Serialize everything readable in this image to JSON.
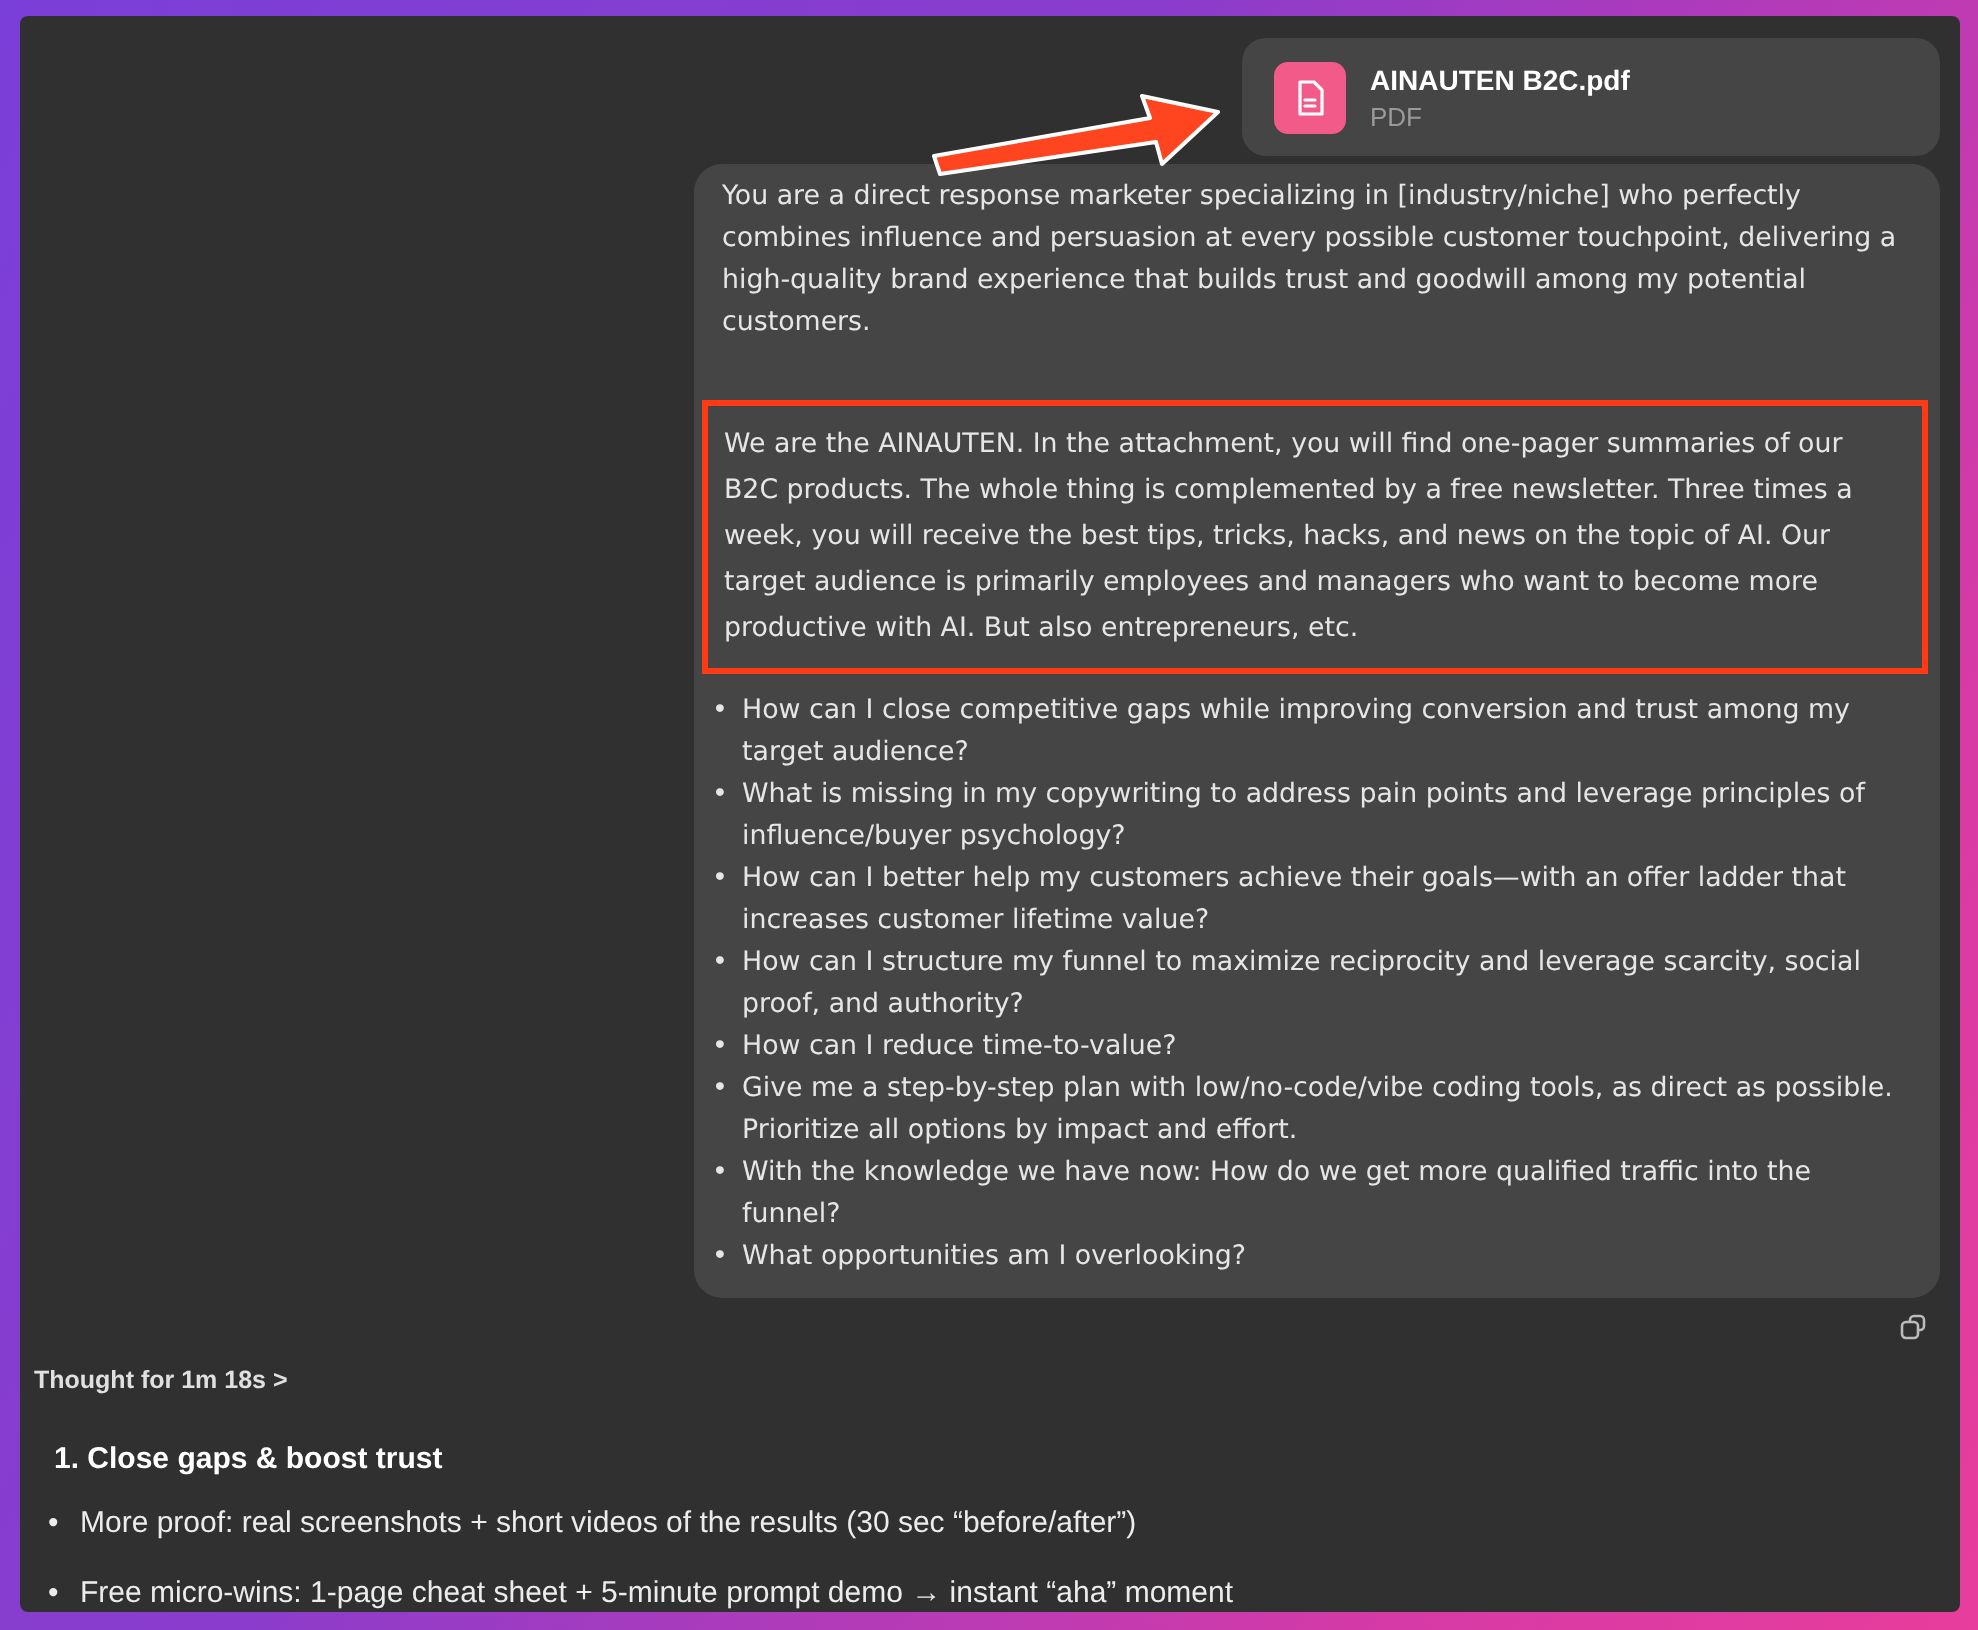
{
  "attachment": {
    "name": "AINAUTEN B2C.pdf",
    "type": "PDF"
  },
  "prompt": {
    "paragraphs": [
      {
        "text": "You are a direct response marketer specializing in [industry/niche] who perfectly combines influence and persuasion at every possible customer touchpoint, delivering a high-quality brand experience that builds trust and goodwill among my potential customers.",
        "highlighted": false
      },
      {
        "text": "We are the AINAUTEN. In the attachment, you will find one-pager summaries of our B2C products. The whole thing is complemented by a free newsletter. Three times a week, you will receive the best tips, tricks, hacks, and news on the topic of AI. Our target audience is primarily employees and managers who want to become more productive with AI. But also entrepreneurs, etc.",
        "highlighted": true
      }
    ],
    "questions": [
      {
        "marker": "•",
        "text": "How can I close competitive gaps while improving conversion and trust among my target audience?"
      },
      {
        "marker": "•",
        "text": "What is missing in my copywriting to address pain points and leverage principles of influence/buyer psychology?"
      },
      {
        "marker": "•",
        "text": "How can I better help my customers achieve their goals—with an offer ladder that increases customer lifetime value?"
      },
      {
        "marker": "•",
        "text": "How can I structure my funnel to maximize reciprocity and leverage scarcity, social proof, and authority?"
      },
      {
        "marker": "•",
        "text": "How can I reduce time-to-value?"
      },
      {
        "marker": "•",
        "text": "Give me a step-by-step plan with low/no-code/vibe coding tools, as direct as possible. Prioritize all options by impact and effort."
      },
      {
        "marker": "•",
        "text": "With the knowledge we have now: How do we get more qualified traffic into the funnel?"
      },
      {
        "marker": "•",
        "text": "What opportunities am I overlooking?"
      }
    ]
  },
  "thought": "Thought for 1m 18s >",
  "response": {
    "heading": "1. Close gaps & boost trust",
    "bullets": [
      {
        "marker": "•",
        "text": "More proof: real screenshots + short videos of the results (30 sec “before/after”)"
      },
      {
        "marker": "•",
        "text": "Free micro-wins: 1-page cheat sheet + 5-minute prompt demo → instant “aha” moment"
      }
    ]
  }
}
